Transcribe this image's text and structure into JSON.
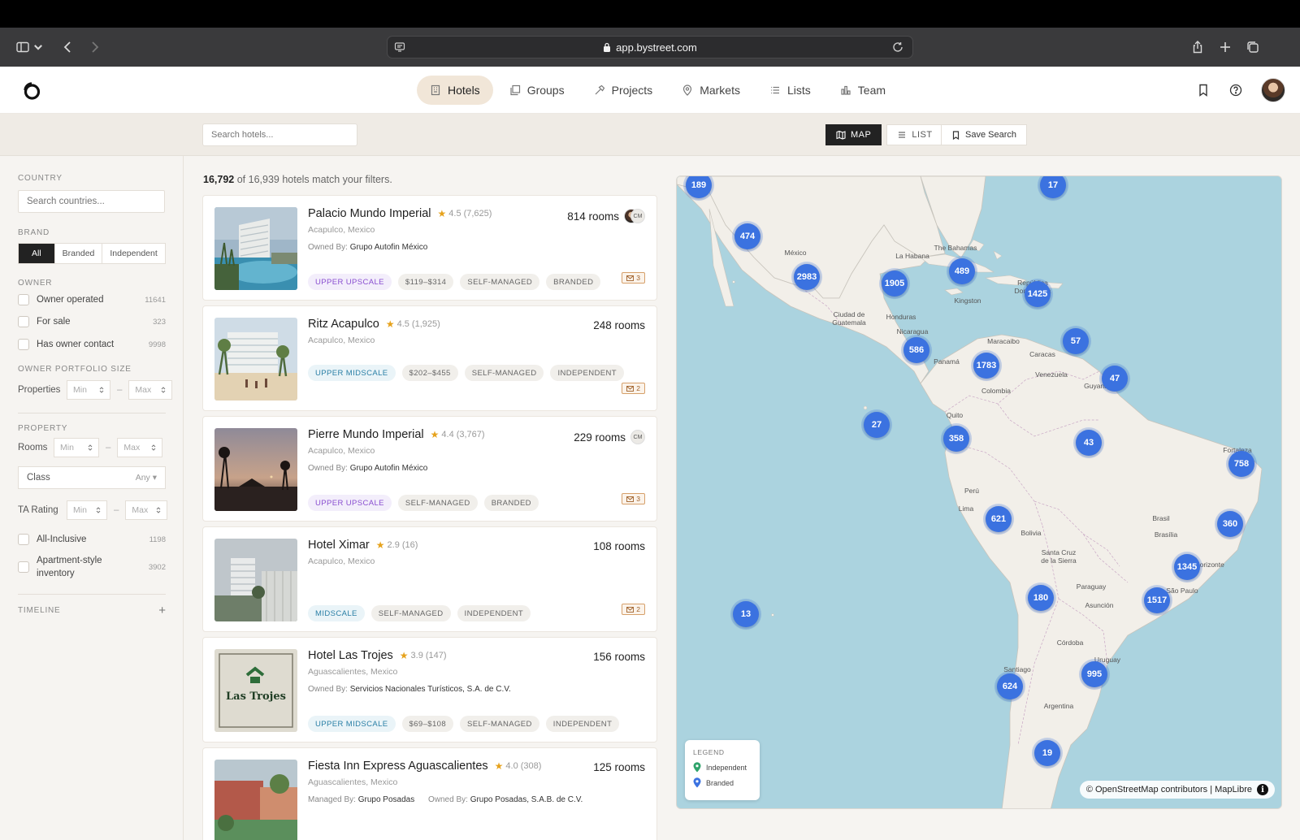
{
  "browser": {
    "url": "app.bystreet.com"
  },
  "nav": {
    "tabs": [
      {
        "label": "Hotels",
        "icon": "building-icon",
        "active": true
      },
      {
        "label": "Groups",
        "icon": "layers-icon"
      },
      {
        "label": "Projects",
        "icon": "hammer-icon"
      },
      {
        "label": "Markets",
        "icon": "map-pin-icon"
      },
      {
        "label": "Lists",
        "icon": "list-icon"
      },
      {
        "label": "Team",
        "icon": "bar-chart-icon"
      }
    ]
  },
  "toolbar": {
    "search_placeholder": "Search hotels...",
    "map_label": "MAP",
    "list_label": "LIST",
    "save_label": "Save Search"
  },
  "sidebar": {
    "country_label": "COUNTRY",
    "country_placeholder": "Search countries...",
    "brand_label": "BRAND",
    "brand_options": [
      "All",
      "Branded",
      "Independent"
    ],
    "owner_label": "OWNER",
    "owner_items": [
      {
        "label": "Owner operated",
        "count": "11641"
      },
      {
        "label": "For sale",
        "count": "323"
      },
      {
        "label": "Has owner contact",
        "count": "9998"
      }
    ],
    "portfolio_label": "OWNER PORTFOLIO SIZE",
    "properties_label": "Properties",
    "min": "Min",
    "max": "Max",
    "property_label": "PROPERTY",
    "rooms_label": "Rooms",
    "class_label": "Class",
    "class_value": "Any",
    "ta_label": "TA Rating",
    "property_items": [
      {
        "label": "All-Inclusive",
        "count": "1198"
      },
      {
        "label": "Apartment-style inventory",
        "count": "3902"
      }
    ],
    "timeline_label": "TIMELINE"
  },
  "results": {
    "matched": "16,792",
    "summary_text": "of 16,939 hotels match your filters."
  },
  "hotels": [
    {
      "name": "Palacio Mundo Imperial",
      "rating": "4.5",
      "reviews": "(7,625)",
      "location": "Acapulco, Mexico",
      "owner_label": "Owned By:",
      "owner": "Grupo Autofin México",
      "rooms": "814 rooms",
      "contacts": "CM",
      "tags": [
        "UPPER UPSCALE",
        "$119–$314",
        "SELF-MANAGED",
        "BRANDED"
      ],
      "mail": "3"
    },
    {
      "name": "Ritz Acapulco",
      "rating": "4.5",
      "reviews": "(1,925)",
      "location": "Acapulco, Mexico",
      "rooms": "248 rooms",
      "tags": [
        "UPPER MIDSCALE",
        "$202–$455",
        "SELF-MANAGED",
        "INDEPENDENT"
      ],
      "mail": "2"
    },
    {
      "name": "Pierre Mundo Imperial",
      "rating": "4.4",
      "reviews": "(3,767)",
      "location": "Acapulco, Mexico",
      "owner_label": "Owned By:",
      "owner": "Grupo Autofin México",
      "rooms": "229 rooms",
      "contacts": "CM",
      "tags": [
        "UPPER UPSCALE",
        "SELF-MANAGED",
        "BRANDED"
      ],
      "mail": "3"
    },
    {
      "name": "Hotel Ximar",
      "rating": "2.9",
      "reviews": "(16)",
      "location": "Acapulco, Mexico",
      "rooms": "108 rooms",
      "tags": [
        "MIDSCALE",
        "SELF-MANAGED",
        "INDEPENDENT"
      ],
      "mail": "2"
    },
    {
      "name": "Hotel Las Trojes",
      "rating": "3.9",
      "reviews": "(147)",
      "location": "Aguascalientes, Mexico",
      "owner_label": "Owned By:",
      "owner": "Servicios Nacionales Turísticos, S.A. de C.V.",
      "rooms": "156 rooms",
      "tags": [
        "UPPER MIDSCALE",
        "$69–$108",
        "SELF-MANAGED",
        "INDEPENDENT"
      ],
      "thumb_text": "Las Trojes"
    },
    {
      "name": "Fiesta Inn Express Aguascalientes",
      "rating": "4.0",
      "reviews": "(308)",
      "location": "Aguascalientes, Mexico",
      "manager_label": "Managed By:",
      "manager": "Grupo Posadas",
      "owner_label": "Owned By:",
      "owner": "Grupo Posadas, S.A.B. de C.V.",
      "rooms": "125 rooms",
      "tags": []
    }
  ],
  "map": {
    "clusters": [
      "189",
      "17",
      "474",
      "2983",
      "1905",
      "489",
      "1425",
      "57",
      "586",
      "1783",
      "47",
      "27",
      "358",
      "43",
      "758",
      "621",
      "360",
      "1345",
      "180",
      "1517",
      "13",
      "995",
      "624",
      "19"
    ],
    "labels": [
      "México",
      "La Habana",
      "The Bahamas",
      "Kingston",
      "República Dominicana",
      "Ciudad de Guatemala",
      "Honduras",
      "Nicaragua",
      "Panamá",
      "Maracaibo",
      "Caracas",
      "Venezuela",
      "Guyana",
      "Colombia",
      "Quito",
      "Perú",
      "Lima",
      "Fortaleza",
      "Brasil",
      "Brasília",
      "Belo Horizonte",
      "Bolivia",
      "Santa Cruz de la Sierra",
      "São Paulo",
      "Paraguay",
      "Asunción",
      "Córdoba",
      "Uruguay",
      "Santiago",
      "Argentina"
    ],
    "legend_title": "LEGEND",
    "legend_items": [
      {
        "label": "Independent",
        "color": "#2fa36b"
      },
      {
        "label": "Branded",
        "color": "#3b72e0"
      }
    ],
    "attribution": "© OpenStreetMap contributors | MapLibre"
  }
}
